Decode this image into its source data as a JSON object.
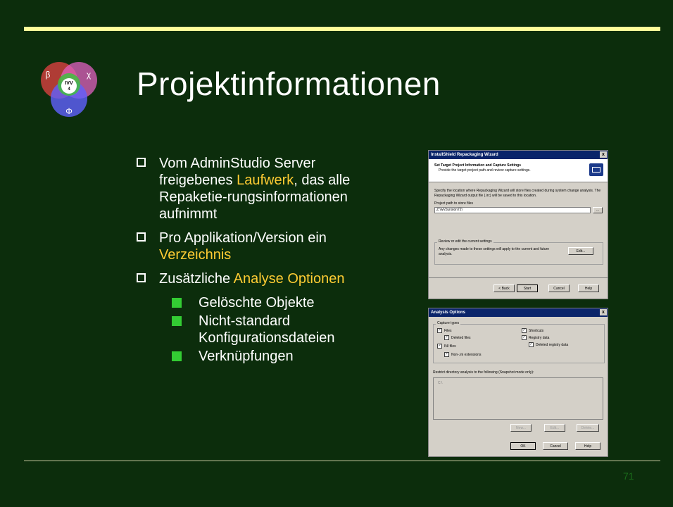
{
  "title": "Projektinformationen",
  "logo": {
    "center": "IVV",
    "sub": "4",
    "top_left": "β",
    "top_right": "χ",
    "bottom": "Φ"
  },
  "bullets": [
    {
      "parts": [
        "Vom AdminStudio Server freigebenes ",
        "Laufwerk",
        ", das alle Repaketie-rungsinformationen aufnimmt"
      ]
    },
    {
      "parts": [
        "Pro Applikation/Version ein ",
        "Verzeichnis",
        ""
      ]
    },
    {
      "parts": [
        "Zusätzliche ",
        "Analyse Optionen",
        ""
      ]
    }
  ],
  "sub_bullets": [
    "Gelöschte Objekte",
    "Nicht-standard Konfigurationsdateien",
    "Verknüpfungen"
  ],
  "page_number": "71",
  "wizard": {
    "title": "InstallShield Repackaging Wizard",
    "close": "x",
    "heading": "Set Target Project Information and Capture Settings",
    "subheading": "Provide the target project path and review capture settings.",
    "description": "Specify the location where Repackaging Wizard will store files created during system change analysis. The Repackaging Wizard output file (.irc) will be saved to this location.",
    "path_label": "Project path to store files",
    "path_value": "Z:\\wVzunsion72\\",
    "browse": "...",
    "group_label": "Review or edit the current settings",
    "group_text": "Any changes made to these settings will apply to the current and future analysis.",
    "edit": "Edit...",
    "back": "< Back",
    "start": "Start",
    "cancel": "Cancel",
    "help": "Help"
  },
  "analysis": {
    "title": "Analysis Options",
    "close": "x",
    "capture_types": "Capture types",
    "files": "Files",
    "deleted_files": "Deleted files",
    "ini_files": "INI files",
    "non_ini": "Non-.ini extensions",
    "shortcuts": "Shortcuts",
    "registry": "Registry data",
    "deleted_registry": "Deleted registry data",
    "restrict": "Restrict directory analysis to the following (Snapshot mode only):",
    "list_item": "C:\\",
    "new": "New...",
    "edit": "Edit...",
    "delete": "Delete...",
    "ok": "OK",
    "cancel": "Cancel",
    "help": "Help"
  }
}
